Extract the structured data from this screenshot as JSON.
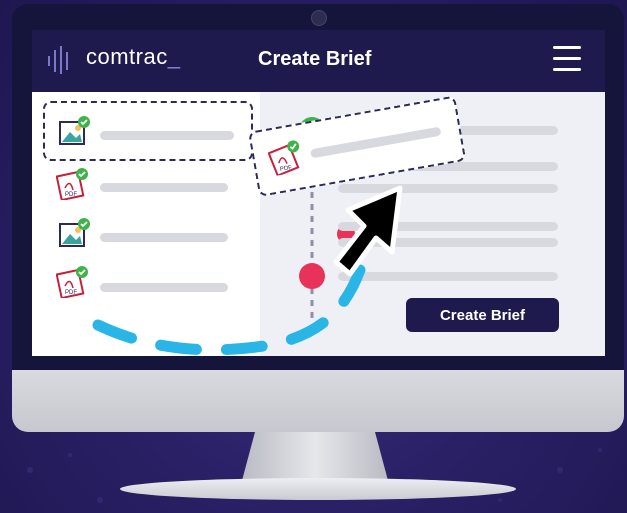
{
  "brand": {
    "name": "comtrac",
    "cursor": "_"
  },
  "header": {
    "title": "Create Brief"
  },
  "actions": {
    "create_brief_label": "Create Brief"
  },
  "files": [
    {
      "type": "image",
      "checked": true
    },
    {
      "type": "pdf",
      "checked": true
    },
    {
      "type": "image",
      "checked": true
    },
    {
      "type": "pdf",
      "checked": true
    }
  ],
  "dragged_file": {
    "type": "pdf",
    "checked": true
  },
  "colors": {
    "navy": "#1e1a4d",
    "accent_cyan": "#29b6e6",
    "green": "#3db34a",
    "red": "#e8325a"
  }
}
